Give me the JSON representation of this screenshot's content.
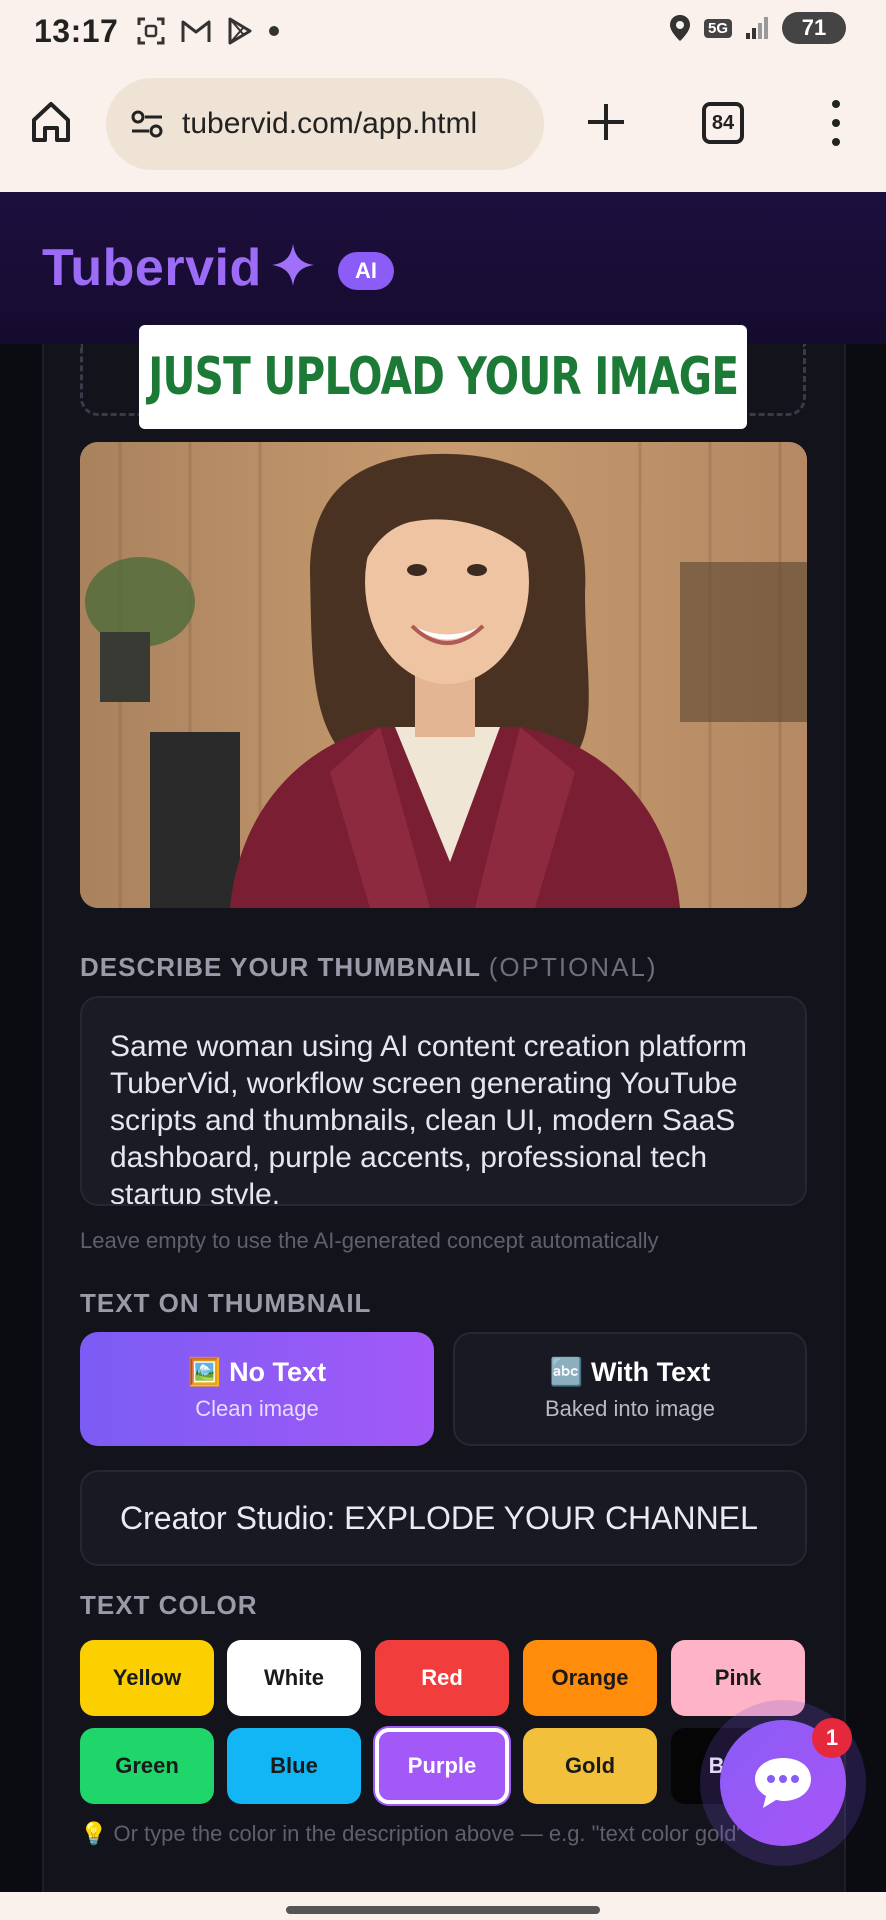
{
  "status_bar": {
    "time": "13:17",
    "network": "5G",
    "battery": "71",
    "icons": [
      "screenshot-icon",
      "gmail-icon",
      "play-store-icon",
      "dot-icon",
      "location-icon",
      "signal-icon"
    ]
  },
  "browser": {
    "url": "tubervid.com/app.html",
    "tab_count": "84"
  },
  "app": {
    "logo": "Tubervid",
    "ai_badge": "AI",
    "brand_color": "#9d6cf7"
  },
  "overlay_banner": "JUST UPLOAD YOUR IMAGE",
  "describe": {
    "label": "DESCRIBE YOUR THUMBNAIL",
    "optional": "(OPTIONAL)",
    "value": "Same woman using AI content creation platform TuberVid, workflow screen generating YouTube scripts and thumbnails, clean UI, modern SaaS dashboard, purple accents, professional tech startup style.",
    "hint": "Leave empty to use the AI-generated concept automatically"
  },
  "text_on_thumbnail": {
    "label": "TEXT ON THUMBNAIL",
    "options": [
      {
        "icon": "🖼️",
        "title": "No Text",
        "subtitle": "Clean image",
        "selected": true
      },
      {
        "icon": "🔤",
        "title": "With Text",
        "subtitle": "Baked into image",
        "selected": false
      }
    ],
    "input_value": "Creator Studio: EXPLODE YOUR CHANNEL"
  },
  "text_color": {
    "label": "TEXT COLOR",
    "colors": [
      {
        "name": "Yellow",
        "bg": "#fcd000",
        "fg": "#1a1a1a"
      },
      {
        "name": "White",
        "bg": "#ffffff",
        "fg": "#1a1a1a"
      },
      {
        "name": "Red",
        "bg": "#f23d3d",
        "fg": "#ffffff"
      },
      {
        "name": "Orange",
        "bg": "#ff8c0a",
        "fg": "#1a1a1a"
      },
      {
        "name": "Pink",
        "bg": "#ffb3c6",
        "fg": "#1a1a1a"
      },
      {
        "name": "Green",
        "bg": "#1fd66a",
        "fg": "#1a1a1a"
      },
      {
        "name": "Blue",
        "bg": "#12b6f5",
        "fg": "#1a1a1a"
      },
      {
        "name": "Purple",
        "bg": "#a259f7",
        "fg": "#ffffff",
        "selected": true
      },
      {
        "name": "Gold",
        "bg": "#f3c03c",
        "fg": "#1a1a1a"
      },
      {
        "name": "Black",
        "bg": "#050505",
        "fg": "#ffffff"
      }
    ],
    "hint": "💡 Or type the color in the description above — e.g. \"text color gold\""
  },
  "chat": {
    "badge": "1"
  }
}
